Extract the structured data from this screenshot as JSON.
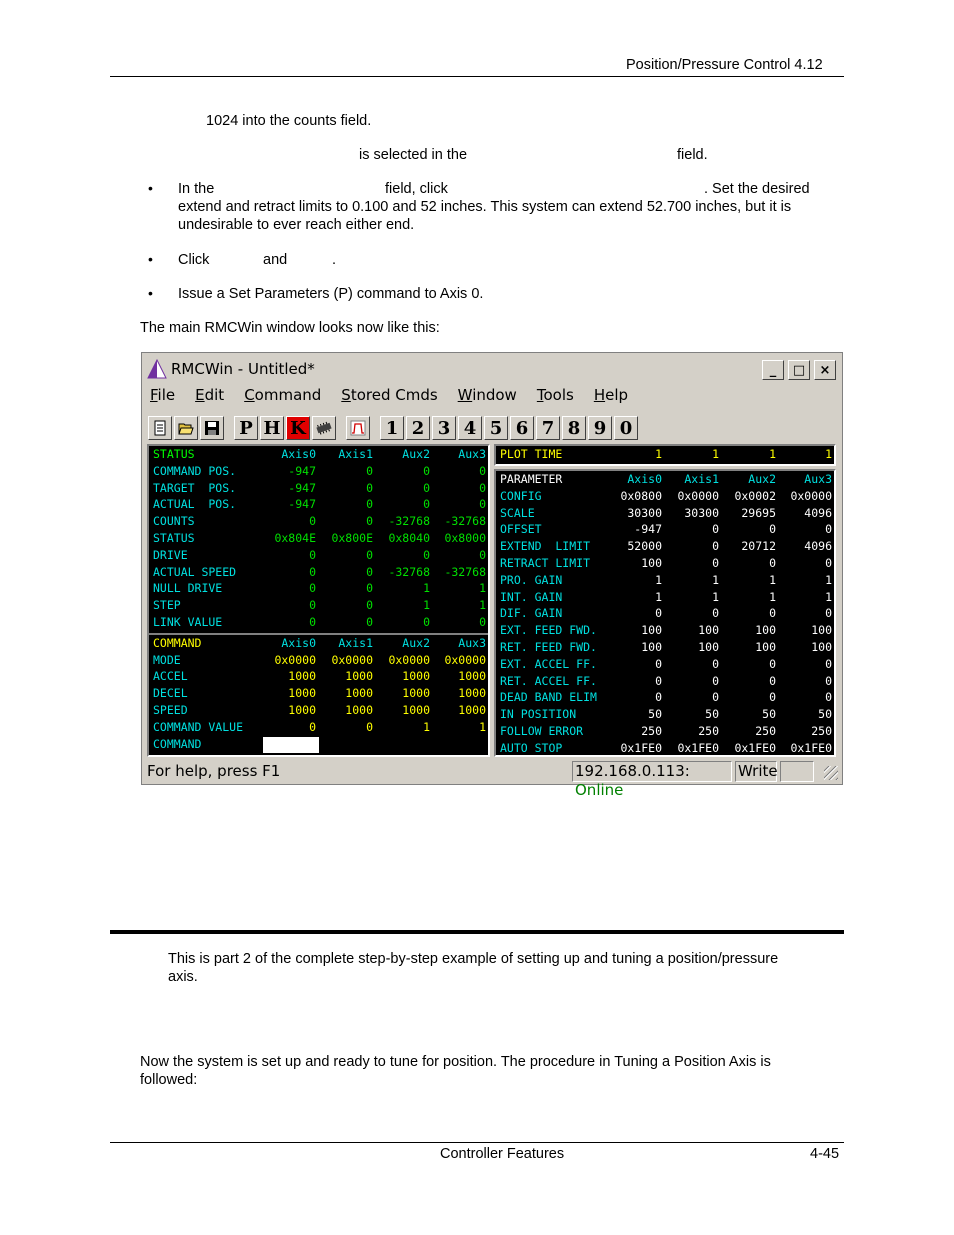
{
  "header": {
    "title": "Position/Pressure Control  4.12"
  },
  "body_lines": {
    "l1": "1024 into the counts field.",
    "l2a": "is selected in the",
    "l2b": "field.",
    "b1a": "In the",
    "b1b": "field, click",
    "b1c": ". Set the desired",
    "b1d": "extend and retract limits to 0.100 and 52 inches. This system can extend 52.700 inches, but it is",
    "b1e": "undesirable to ever reach either end.",
    "b2a": "Click",
    "b2b": "and",
    "b2c": ".",
    "b3": "Issue a Set Parameters (P) command to Axis 0.",
    "intro": "The main RMCWin window looks now like this:"
  },
  "bullet_glyph": "•",
  "window": {
    "title": "RMCWin - Untitled*",
    "controls": [
      "_",
      "□",
      "×"
    ],
    "menu": [
      {
        "label": "File",
        "u": "F",
        "rest": "ile"
      },
      {
        "label": "Edit",
        "u": "E",
        "rest": "dit"
      },
      {
        "label": "Command",
        "u": "C",
        "rest": "ommand"
      },
      {
        "label": "Stored Cmds",
        "u": "S",
        "rest": "tored Cmds"
      },
      {
        "label": "Window",
        "u": "W",
        "rest": "indow"
      },
      {
        "label": "Tools",
        "u": "T",
        "rest": "ools"
      },
      {
        "label": "Help",
        "u": "H",
        "rest": "elp"
      }
    ],
    "toolbar": {
      "icons": [
        "new-icon",
        "open-icon",
        "save-icon"
      ],
      "letters": [
        "P",
        "H",
        "K"
      ],
      "numbers": [
        "1",
        "2",
        "3",
        "4",
        "5",
        "6",
        "7",
        "8",
        "9",
        "0"
      ]
    },
    "status_panel": {
      "header": [
        "STATUS",
        "Axis0",
        "Axis1",
        "Aux2",
        "Aux3"
      ],
      "rows": [
        {
          "label": "COMMAND POS.",
          "values": [
            "-947",
            "0",
            "0",
            "0"
          ]
        },
        {
          "label": "TARGET  POS.",
          "values": [
            "-947",
            "0",
            "0",
            "0"
          ]
        },
        {
          "label": "ACTUAL  POS.",
          "values": [
            "-947",
            "0",
            "0",
            "0"
          ]
        },
        {
          "label": "COUNTS",
          "values": [
            "0",
            "0",
            "-32768",
            "-32768"
          ]
        },
        {
          "label": "STATUS",
          "values": [
            "0x804E",
            "0x800E",
            "0x8040",
            "0x8000"
          ]
        },
        {
          "label": "DRIVE",
          "values": [
            "0",
            "0",
            "0",
            "0"
          ]
        },
        {
          "label": "ACTUAL SPEED",
          "values": [
            "0",
            "0",
            "-32768",
            "-32768"
          ]
        },
        {
          "label": "NULL DRIVE",
          "values": [
            "0",
            "0",
            "1",
            "1"
          ]
        },
        {
          "label": "STEP",
          "values": [
            "0",
            "0",
            "1",
            "1"
          ]
        },
        {
          "label": "LINK VALUE",
          "values": [
            "0",
            "0",
            "0",
            "0"
          ]
        }
      ]
    },
    "command_panel": {
      "header": [
        "COMMAND",
        "Axis0",
        "Axis1",
        "Aux2",
        "Aux3"
      ],
      "rows": [
        {
          "label": "MODE",
          "values": [
            "0x0000",
            "0x0000",
            "0x0000",
            "0x0000"
          ]
        },
        {
          "label": "ACCEL",
          "values": [
            "1000",
            "1000",
            "1000",
            "1000"
          ]
        },
        {
          "label": "DECEL",
          "values": [
            "1000",
            "1000",
            "1000",
            "1000"
          ]
        },
        {
          "label": "SPEED",
          "values": [
            "1000",
            "1000",
            "1000",
            "1000"
          ]
        },
        {
          "label": "COMMAND VALUE",
          "values": [
            "0",
            "0",
            "1",
            "1"
          ]
        },
        {
          "label": "COMMAND",
          "values": [
            "",
            "",
            "",
            ""
          ]
        }
      ]
    },
    "plot_panel": {
      "label": "PLOT TIME",
      "values": [
        "1",
        "1",
        "1",
        "1"
      ]
    },
    "param_panel": {
      "header": [
        "PARAMETER",
        "Axis0",
        "Axis1",
        "Aux2",
        "Aux3"
      ],
      "rows": [
        {
          "label": "CONFIG",
          "values": [
            "0x0800",
            "0x0000",
            "0x0002",
            "0x0000"
          ]
        },
        {
          "label": "SCALE",
          "values": [
            "30300",
            "30300",
            "29695",
            "4096"
          ]
        },
        {
          "label": "OFFSET",
          "values": [
            "-947",
            "0",
            "0",
            "0"
          ]
        },
        {
          "label": "EXTEND  LIMIT",
          "values": [
            "52000",
            "0",
            "20712",
            "4096"
          ]
        },
        {
          "label": "RETRACT LIMIT",
          "values": [
            "100",
            "0",
            "0",
            "0"
          ]
        },
        {
          "label": "PRO. GAIN",
          "values": [
            "1",
            "1",
            "1",
            "1"
          ]
        },
        {
          "label": "INT. GAIN",
          "values": [
            "1",
            "1",
            "1",
            "1"
          ]
        },
        {
          "label": "DIF. GAIN",
          "values": [
            "0",
            "0",
            "0",
            "0"
          ]
        },
        {
          "label": "EXT. FEED FWD.",
          "values": [
            "100",
            "100",
            "100",
            "100"
          ]
        },
        {
          "label": "RET. FEED FWD.",
          "values": [
            "100",
            "100",
            "100",
            "100"
          ]
        },
        {
          "label": "EXT. ACCEL FF.",
          "values": [
            "0",
            "0",
            "0",
            "0"
          ]
        },
        {
          "label": "RET. ACCEL FF.",
          "values": [
            "0",
            "0",
            "0",
            "0"
          ]
        },
        {
          "label": "DEAD BAND ELIM",
          "values": [
            "0",
            "0",
            "0",
            "0"
          ]
        },
        {
          "label": "IN POSITION",
          "values": [
            "50",
            "50",
            "50",
            "50"
          ]
        },
        {
          "label": "FOLLOW ERROR",
          "values": [
            "250",
            "250",
            "250",
            "250"
          ]
        },
        {
          "label": "AUTO STOP",
          "values": [
            "0x1FE0",
            "0x1FE0",
            "0x1FE0",
            "0x1FE0"
          ]
        }
      ]
    },
    "statusbar": {
      "help": "For help, press F1",
      "address": "192.168.0.113:",
      "connection": "Online",
      "mode": "Write",
      "empty": ""
    }
  },
  "colors": {
    "label": "#00e0e0",
    "value_status": "#00e000",
    "value_command": "#ffff00",
    "online": "#008000"
  },
  "after": {
    "p1a": "This is part 2 of the complete step-by-step example of setting up and tuning a position/pressure",
    "p1b": "axis.",
    "p2a": "Now the system is set up and ready to tune for position. The procedure in Tuning a Position Axis is",
    "p2b": "followed:"
  },
  "footer": {
    "center": "Controller Features",
    "page": "4-45"
  }
}
